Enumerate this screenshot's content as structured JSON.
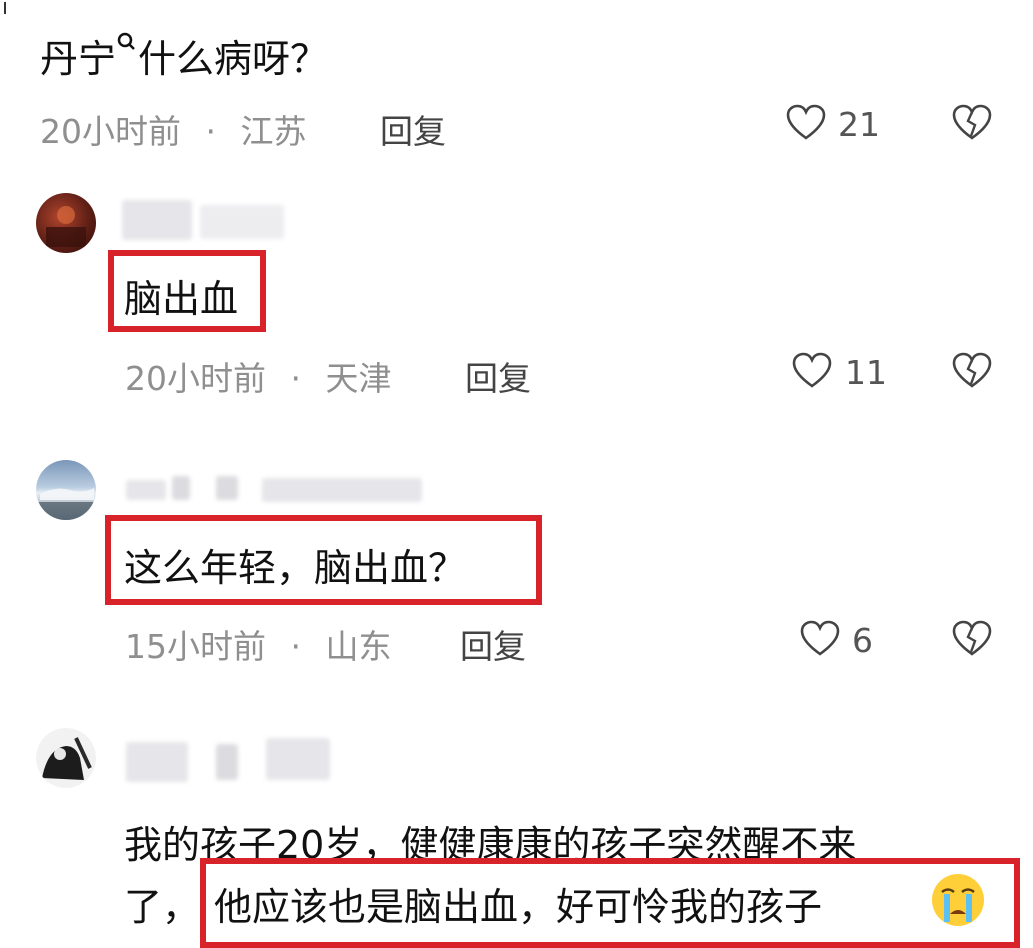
{
  "top": {
    "question_part1": "丹宁",
    "question_part2": "什么病呀？",
    "time": "20小时前",
    "location": "江苏",
    "reply": "回复",
    "likes": "21"
  },
  "comments": [
    {
      "text": "脑出血",
      "time": "20小时前",
      "location": "天津",
      "reply": "回复",
      "likes": "11"
    },
    {
      "text": "这么年轻，脑出血？",
      "time": "15小时前",
      "location": "山东",
      "reply": "回复",
      "likes": "6"
    },
    {
      "line1": "我的孩子20岁，健健康康的孩子突然醒不来",
      "line2_prefix": "了，",
      "line2_highlight": "他应该也是脑出血，好可怜我的孩子",
      "emoji": "crying-face"
    }
  ],
  "colors": {
    "highlight_border": "#d8232a",
    "meta_text": "#8f8f8f"
  }
}
